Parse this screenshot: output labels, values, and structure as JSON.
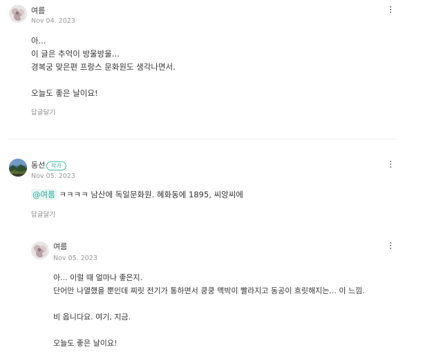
{
  "comments": [
    {
      "author": "여름",
      "date": "Nov 04. 2023",
      "lines": [
        "아...",
        "이 글은 추억이 방울방울...",
        "경복궁 맞은편 프랑스 문화원도 생각나면서.",
        "",
        "오늘도 좋은 날이요!"
      ],
      "reply_label": "답글달기",
      "avatar_icon": "flower-avatar-icon"
    },
    {
      "author": "동선",
      "badge": "작가",
      "date": "Nov 05. 2023",
      "mention": "@여름",
      "text": " ㅋㅋㅋㅋ 남산에 독일문화원. 혜화동에 1895, 씨앙씨에",
      "reply_label": "답글달기",
      "avatar_icon": "landscape-avatar-icon"
    },
    {
      "author": "여름",
      "date": "Nov 05. 2023",
      "lines": [
        "아... 이럴 때 얼마나 좋은지.",
        "단어만 나열했을 뿐인데 찌릿 전기가 통하면서 쿵쿵 맥박이 빨라지고 동공이 흐릿해지는... 이 느낌.",
        "",
        "비 옵니다요. 여기, 지금.",
        "",
        "오늘도 좋은 날이요!"
      ],
      "avatar_icon": "flower-avatar-icon"
    }
  ],
  "more_icon": "more-vertical-icon",
  "colors": {
    "accent": "#2fa89a",
    "meta": "#999999",
    "text": "#333333",
    "divider": "#ececec"
  }
}
